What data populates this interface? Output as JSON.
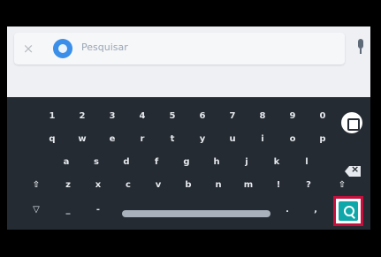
{
  "search": {
    "close_glyph": "×",
    "placeholder": "Pesquisar",
    "logo_icon": "google-logo-icon",
    "mic_icon": "microphone-icon"
  },
  "keyboard": {
    "row1": [
      "1",
      "2",
      "3",
      "4",
      "5",
      "6",
      "7",
      "8",
      "9",
      "0"
    ],
    "row2": [
      "q",
      "w",
      "e",
      "r",
      "t",
      "y",
      "u",
      "i",
      "o",
      "p"
    ],
    "row3": [
      "a",
      "s",
      "d",
      "f",
      "g",
      "h",
      "j",
      "k",
      "l"
    ],
    "row4": [
      "⇧",
      "z",
      "x",
      "c",
      "v",
      "b",
      "n",
      "m",
      "!",
      "?",
      "⇧"
    ],
    "row5": [
      "▽",
      "_",
      "-",
      ".",
      ","
    ],
    "icons": {
      "emoji": "emoji-icon",
      "backspace": "backspace-icon",
      "search_action": "search-icon"
    }
  },
  "colors": {
    "keyboard_bg": "#252b33",
    "accent": "#0fa7a9",
    "highlight": "#c4113e"
  }
}
